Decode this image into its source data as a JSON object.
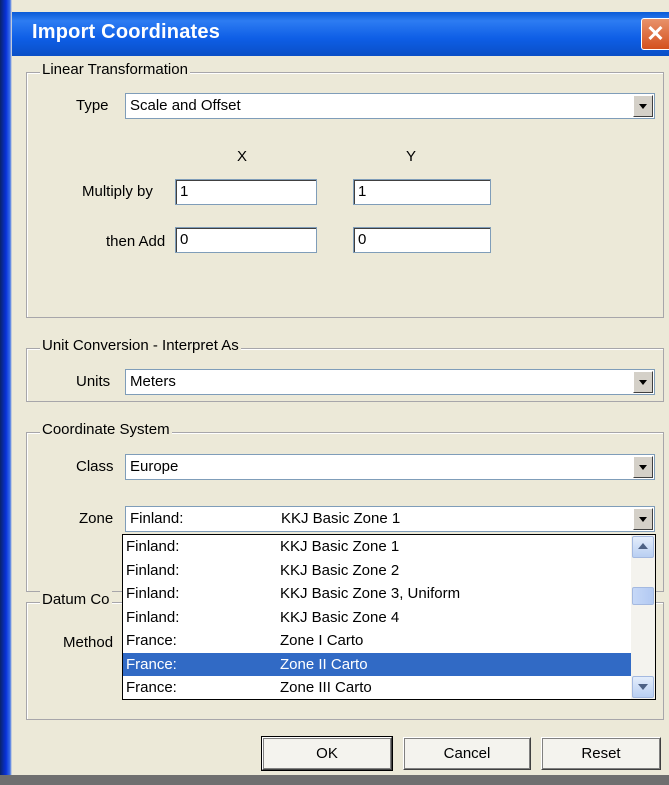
{
  "window": {
    "title": "Import Coordinates",
    "close_symbol": "✕"
  },
  "linear_transformation": {
    "group_label": "Linear Transformation",
    "type_label": "Type",
    "type_value": "Scale and Offset",
    "x_header": "X",
    "y_header": "Y",
    "multiply_label": "Multiply by",
    "multiply_x": "1",
    "multiply_y": "1",
    "add_label": "then Add",
    "add_x": "0",
    "add_y": "0"
  },
  "unit_conversion": {
    "group_label": "Unit Conversion - Interpret As",
    "units_label": "Units",
    "units_value": "Meters"
  },
  "coordinate_system": {
    "group_label": "Coordinate System",
    "class_label": "Class",
    "class_value": "Europe",
    "zone_label": "Zone",
    "zone_country": "Finland:",
    "zone_name": "KKJ Basic Zone 1",
    "zone_options": [
      {
        "country": "Finland:",
        "zone": "KKJ Basic Zone 1"
      },
      {
        "country": "Finland:",
        "zone": "KKJ Basic Zone 2"
      },
      {
        "country": "Finland:",
        "zone": "KKJ Basic Zone 3, Uniform"
      },
      {
        "country": "Finland:",
        "zone": "KKJ Basic Zone 4"
      },
      {
        "country": "France:",
        "zone": "Zone I Carto"
      },
      {
        "country": "France:",
        "zone": "Zone II Carto"
      },
      {
        "country": "France:",
        "zone": "Zone III Carto"
      }
    ],
    "highlighted_index": 5
  },
  "datum_conversion": {
    "group_label": "Datum Co",
    "method_label": "Method"
  },
  "buttons": {
    "ok": "OK",
    "cancel": "Cancel",
    "reset": "Reset"
  },
  "colors": {
    "titlebar": "#0a5bd6",
    "selection": "#316ac5",
    "dialog_bg": "#ece9d8",
    "close_button": "#d4501e"
  }
}
